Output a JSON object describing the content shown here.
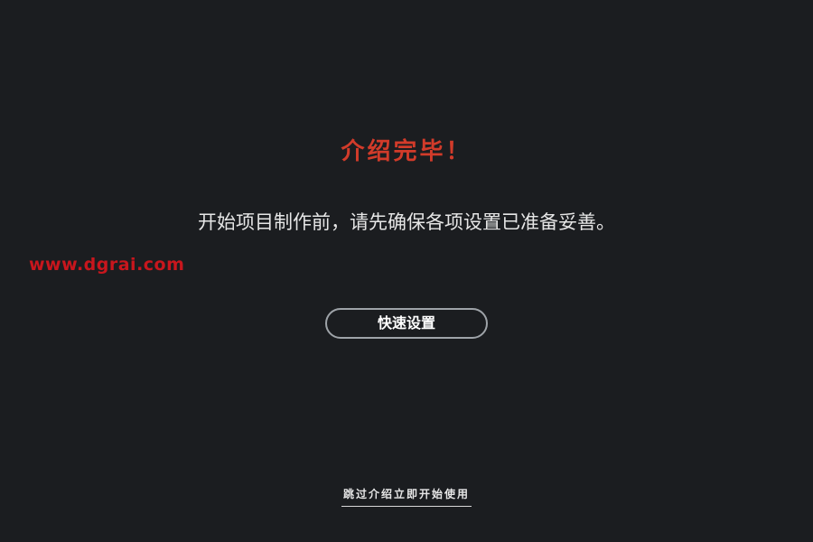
{
  "intro": {
    "title": "介绍完毕！",
    "message": "开始项目制作前，请先确保各项设置已准备妥善。",
    "watermark": "www.dgrai.com",
    "quick_setup_label": "快速设置",
    "skip_label": "跳过介绍立即开始使用"
  },
  "colors": {
    "title": "#d23b2a",
    "message": "#e6e6e6",
    "watermark": "#c8161d",
    "button_text": "#ffffff",
    "skip_text": "#e6e6e6"
  }
}
